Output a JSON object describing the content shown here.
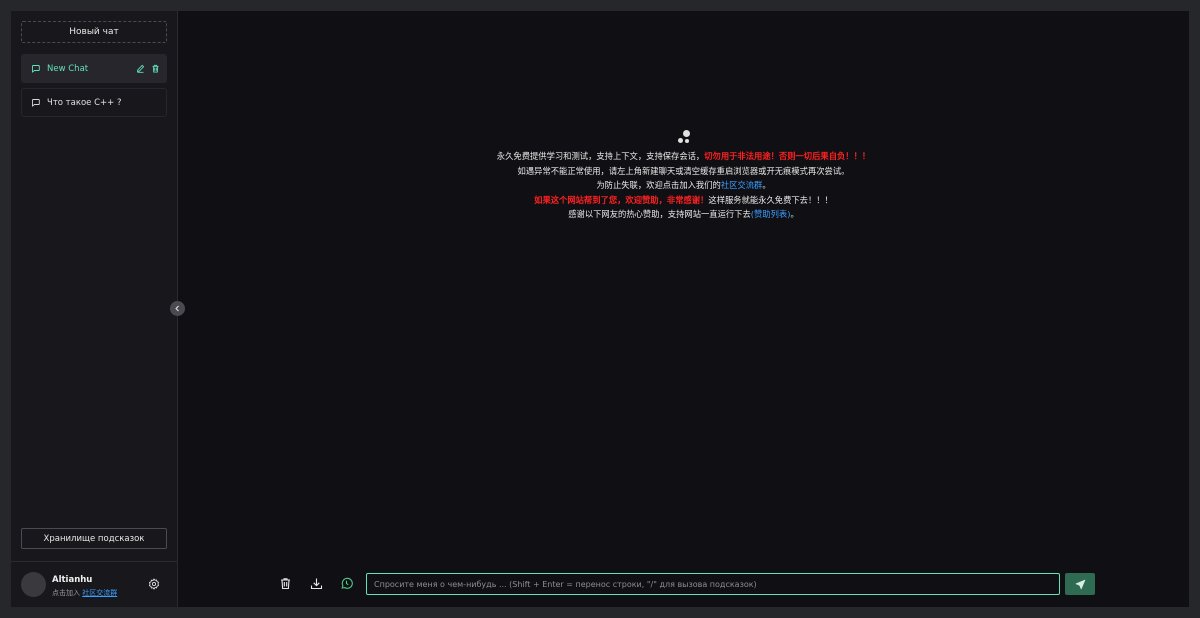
{
  "sidebar": {
    "new_chat_label": "Новый чат",
    "chats": [
      {
        "label": "New Chat",
        "active": true
      },
      {
        "label": "Что такое C++ ?",
        "active": false
      }
    ],
    "prompt_store_label": "Хранилище подсказок",
    "user": {
      "name": "Altianhu",
      "desc_prefix": "点击加入",
      "desc_link": "社区交流群"
    }
  },
  "notice": {
    "line1_text": "永久免费提供学习和测试，支持上下文，支持保存会话，",
    "line1_red": "切勿用于非法用途！否则一切后果自负！！！",
    "line2": "如遇异常不能正常使用，请左上角新建聊天或清空缓存重启浏览器或开无痕模式再次尝试。",
    "line3_prefix": "为防止失联，欢迎点击加入我们的",
    "line3_link": "社区交流群",
    "line3_suffix": "。",
    "line4_red": "如果这个网站帮到了您，欢迎赞助，非常感谢！",
    "line4_text": "这样服务就能永久免费下去！！！",
    "line5_prefix": "感谢以下网友的热心赞助，支持网站一直运行下去",
    "line5_link": "(赞助列表)",
    "line5_suffix": "。"
  },
  "input": {
    "placeholder": "Спросите меня о чем-нибудь ... (Shift + Enter = перенос строки, \"/\" для вызова подсказок)",
    "value": ""
  },
  "colors": {
    "accent": "#63e2b7",
    "background": "#101014",
    "sidebar": "#18181c",
    "warning_red": "#ff2020",
    "link_blue": "#3b9eff",
    "send_button": "#2f6b53"
  },
  "icons": {
    "chat": "chat-bubble-icon",
    "edit": "edit-icon",
    "delete": "trash-icon",
    "settings": "gear-icon",
    "collapse": "chevron-left-icon",
    "clear": "trash-icon",
    "download": "download-icon",
    "context": "clock-icon",
    "send": "send-icon"
  }
}
